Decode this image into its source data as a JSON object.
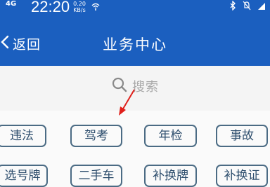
{
  "status_bar": {
    "network": "4G",
    "time": "22:20",
    "speed_value": "0.20",
    "speed_unit": "KB/s",
    "wifi_icon": "wifi-icon",
    "icons_right": [
      "bluetooth-icon",
      "mute-icon",
      "signal-icon"
    ]
  },
  "header": {
    "back_label": "返回",
    "title": "业务中心",
    "background": "#1b5fbf"
  },
  "search": {
    "placeholder": "搜索",
    "icon": "search-icon"
  },
  "services": {
    "row1": [
      "违法",
      "驾考",
      "年检",
      "事故"
    ],
    "row2": [
      "选号牌",
      "二手车",
      "补换牌",
      "补换证"
    ],
    "accent": "#4b6b84"
  },
  "annotation": {
    "arrow_color": "#e0201b"
  }
}
